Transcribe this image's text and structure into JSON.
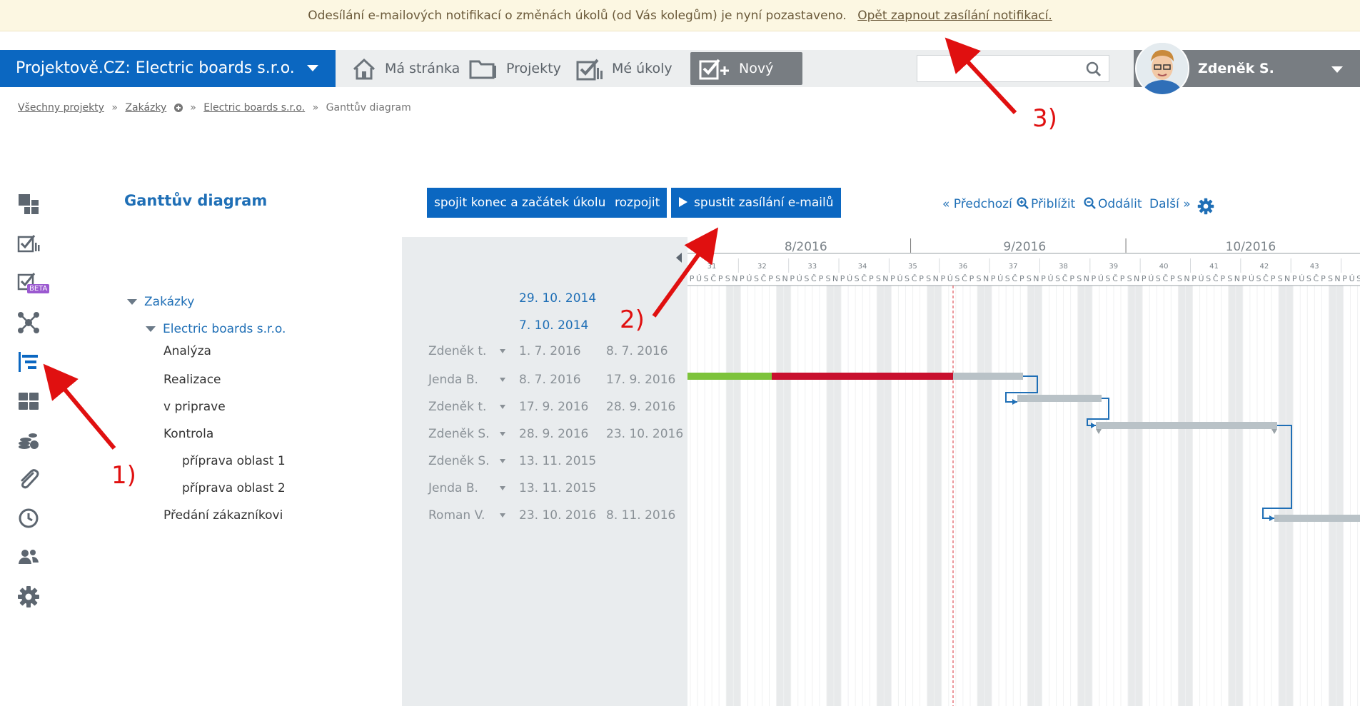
{
  "notice": {
    "text": "Odesílání e-mailových notifikací o změnách úkolů (od Vás kolegům) je nyní pozastaveno.",
    "link": "Opět zapnout zasílání notifikací."
  },
  "brand": {
    "title": "Projektově.CZ: Electric boards s.r.o."
  },
  "nav": [
    {
      "label": "Má stránka",
      "icon": "home-icon"
    },
    {
      "label": "Projekty",
      "icon": "folder-icon"
    },
    {
      "label": "Mé úkoly",
      "icon": "tasks-icon"
    }
  ],
  "new_task": {
    "label": "Nový úkol",
    "icon": "add-task-icon"
  },
  "search": {
    "placeholder": ""
  },
  "user": {
    "name": "Zdeněk S."
  },
  "breadcrumb": {
    "items": [
      "Všechny projekty",
      "Zakázky",
      "Electric boards s.r.o.",
      "Ganttův diagram"
    ],
    "sep": "»"
  },
  "page_title": "Ganttův diagram",
  "rail_badge": "BETA",
  "actions": {
    "link": "spojit konec a začátek úkolu",
    "unlink": "rozpojit",
    "mail": "spustit zasílání e-mailů"
  },
  "gantt_toolbar": {
    "prev": "« Předchozí",
    "zoom_in": "Přiblížit",
    "zoom_out": "Oddálit",
    "next": "Další »"
  },
  "months": [
    "8/2016",
    "9/2016",
    "10/2016"
  ],
  "weeks": [
    "31",
    "32",
    "33",
    "34",
    "35",
    "36",
    "37",
    "38",
    "39",
    "40",
    "41",
    "42",
    "43"
  ],
  "day_letters": [
    "P",
    "Ú",
    "S",
    "Č",
    "P",
    "S",
    "N"
  ],
  "tree": [
    {
      "label": "Zakázky",
      "level": 0,
      "link": true,
      "expanded": true
    },
    {
      "label": "Electric boards s.r.o.",
      "level": 1,
      "link": true,
      "expanded": true
    },
    {
      "label": "Analýza",
      "level": 2
    },
    {
      "label": "Realizace",
      "level": 2
    },
    {
      "label": "v priprave",
      "level": 2
    },
    {
      "label": "Kontrola",
      "level": 2
    },
    {
      "label": "příprava oblast 1",
      "level": 3
    },
    {
      "label": "příprava oblast 2",
      "level": 3
    },
    {
      "label": "Předání zákazníkovi",
      "level": 2
    }
  ],
  "rows": [
    {
      "assignee": "",
      "start": "29. 10. 2014",
      "end": ""
    },
    {
      "assignee": "",
      "start": "7. 10. 2014",
      "end": ""
    },
    {
      "assignee": "Zdeněk t.",
      "start": "1. 7. 2016",
      "end": "8. 7. 2016"
    },
    {
      "assignee": "Jenda B.",
      "start": "8. 7. 2016",
      "end": "17. 9. 2016"
    },
    {
      "assignee": "Zdeněk t.",
      "start": "17. 9. 2016",
      "end": "28. 9. 2016"
    },
    {
      "assignee": "Zdeněk S.",
      "start": "28. 9. 2016",
      "end": "23. 10. 2016"
    },
    {
      "assignee": "Zdeněk S.",
      "start": "13. 11. 2015",
      "end": ""
    },
    {
      "assignee": "Jenda B.",
      "start": "13. 11. 2015",
      "end": ""
    },
    {
      "assignee": "Roman V.",
      "start": "23. 10. 2016",
      "end": "8. 11. 2016"
    }
  ],
  "colors": {
    "primary": "#0b67c1",
    "progress_done": "#7dc33b",
    "progress_late": "#c8102e",
    "bar_grey": "#b9c2c7",
    "today_line": "#d9303a"
  },
  "annotations": [
    "1)",
    "2)",
    "3)"
  ]
}
